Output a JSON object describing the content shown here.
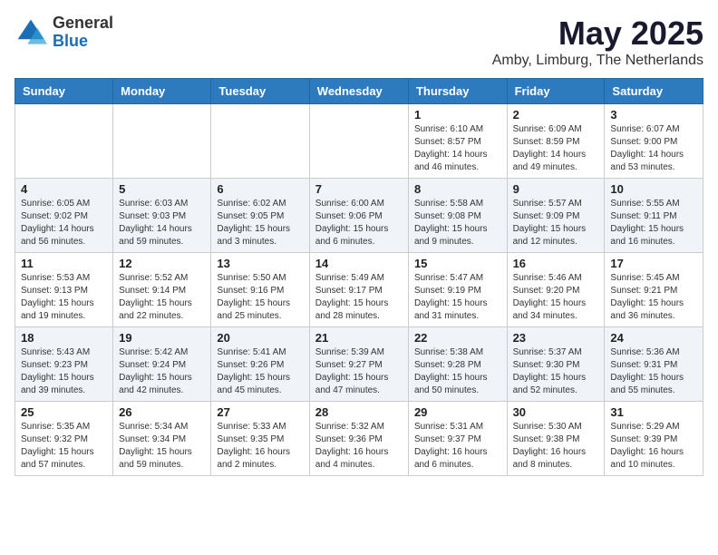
{
  "logo": {
    "general": "General",
    "blue": "Blue"
  },
  "header": {
    "month": "May 2025",
    "location": "Amby, Limburg, The Netherlands"
  },
  "weekdays": [
    "Sunday",
    "Monday",
    "Tuesday",
    "Wednesday",
    "Thursday",
    "Friday",
    "Saturday"
  ],
  "weeks": [
    [
      {
        "day": "",
        "info": ""
      },
      {
        "day": "",
        "info": ""
      },
      {
        "day": "",
        "info": ""
      },
      {
        "day": "",
        "info": ""
      },
      {
        "day": "1",
        "info": "Sunrise: 6:10 AM\nSunset: 8:57 PM\nDaylight: 14 hours\nand 46 minutes."
      },
      {
        "day": "2",
        "info": "Sunrise: 6:09 AM\nSunset: 8:59 PM\nDaylight: 14 hours\nand 49 minutes."
      },
      {
        "day": "3",
        "info": "Sunrise: 6:07 AM\nSunset: 9:00 PM\nDaylight: 14 hours\nand 53 minutes."
      }
    ],
    [
      {
        "day": "4",
        "info": "Sunrise: 6:05 AM\nSunset: 9:02 PM\nDaylight: 14 hours\nand 56 minutes."
      },
      {
        "day": "5",
        "info": "Sunrise: 6:03 AM\nSunset: 9:03 PM\nDaylight: 14 hours\nand 59 minutes."
      },
      {
        "day": "6",
        "info": "Sunrise: 6:02 AM\nSunset: 9:05 PM\nDaylight: 15 hours\nand 3 minutes."
      },
      {
        "day": "7",
        "info": "Sunrise: 6:00 AM\nSunset: 9:06 PM\nDaylight: 15 hours\nand 6 minutes."
      },
      {
        "day": "8",
        "info": "Sunrise: 5:58 AM\nSunset: 9:08 PM\nDaylight: 15 hours\nand 9 minutes."
      },
      {
        "day": "9",
        "info": "Sunrise: 5:57 AM\nSunset: 9:09 PM\nDaylight: 15 hours\nand 12 minutes."
      },
      {
        "day": "10",
        "info": "Sunrise: 5:55 AM\nSunset: 9:11 PM\nDaylight: 15 hours\nand 16 minutes."
      }
    ],
    [
      {
        "day": "11",
        "info": "Sunrise: 5:53 AM\nSunset: 9:13 PM\nDaylight: 15 hours\nand 19 minutes."
      },
      {
        "day": "12",
        "info": "Sunrise: 5:52 AM\nSunset: 9:14 PM\nDaylight: 15 hours\nand 22 minutes."
      },
      {
        "day": "13",
        "info": "Sunrise: 5:50 AM\nSunset: 9:16 PM\nDaylight: 15 hours\nand 25 minutes."
      },
      {
        "day": "14",
        "info": "Sunrise: 5:49 AM\nSunset: 9:17 PM\nDaylight: 15 hours\nand 28 minutes."
      },
      {
        "day": "15",
        "info": "Sunrise: 5:47 AM\nSunset: 9:19 PM\nDaylight: 15 hours\nand 31 minutes."
      },
      {
        "day": "16",
        "info": "Sunrise: 5:46 AM\nSunset: 9:20 PM\nDaylight: 15 hours\nand 34 minutes."
      },
      {
        "day": "17",
        "info": "Sunrise: 5:45 AM\nSunset: 9:21 PM\nDaylight: 15 hours\nand 36 minutes."
      }
    ],
    [
      {
        "day": "18",
        "info": "Sunrise: 5:43 AM\nSunset: 9:23 PM\nDaylight: 15 hours\nand 39 minutes."
      },
      {
        "day": "19",
        "info": "Sunrise: 5:42 AM\nSunset: 9:24 PM\nDaylight: 15 hours\nand 42 minutes."
      },
      {
        "day": "20",
        "info": "Sunrise: 5:41 AM\nSunset: 9:26 PM\nDaylight: 15 hours\nand 45 minutes."
      },
      {
        "day": "21",
        "info": "Sunrise: 5:39 AM\nSunset: 9:27 PM\nDaylight: 15 hours\nand 47 minutes."
      },
      {
        "day": "22",
        "info": "Sunrise: 5:38 AM\nSunset: 9:28 PM\nDaylight: 15 hours\nand 50 minutes."
      },
      {
        "day": "23",
        "info": "Sunrise: 5:37 AM\nSunset: 9:30 PM\nDaylight: 15 hours\nand 52 minutes."
      },
      {
        "day": "24",
        "info": "Sunrise: 5:36 AM\nSunset: 9:31 PM\nDaylight: 15 hours\nand 55 minutes."
      }
    ],
    [
      {
        "day": "25",
        "info": "Sunrise: 5:35 AM\nSunset: 9:32 PM\nDaylight: 15 hours\nand 57 minutes."
      },
      {
        "day": "26",
        "info": "Sunrise: 5:34 AM\nSunset: 9:34 PM\nDaylight: 15 hours\nand 59 minutes."
      },
      {
        "day": "27",
        "info": "Sunrise: 5:33 AM\nSunset: 9:35 PM\nDaylight: 16 hours\nand 2 minutes."
      },
      {
        "day": "28",
        "info": "Sunrise: 5:32 AM\nSunset: 9:36 PM\nDaylight: 16 hours\nand 4 minutes."
      },
      {
        "day": "29",
        "info": "Sunrise: 5:31 AM\nSunset: 9:37 PM\nDaylight: 16 hours\nand 6 minutes."
      },
      {
        "day": "30",
        "info": "Sunrise: 5:30 AM\nSunset: 9:38 PM\nDaylight: 16 hours\nand 8 minutes."
      },
      {
        "day": "31",
        "info": "Sunrise: 5:29 AM\nSunset: 9:39 PM\nDaylight: 16 hours\nand 10 minutes."
      }
    ]
  ]
}
